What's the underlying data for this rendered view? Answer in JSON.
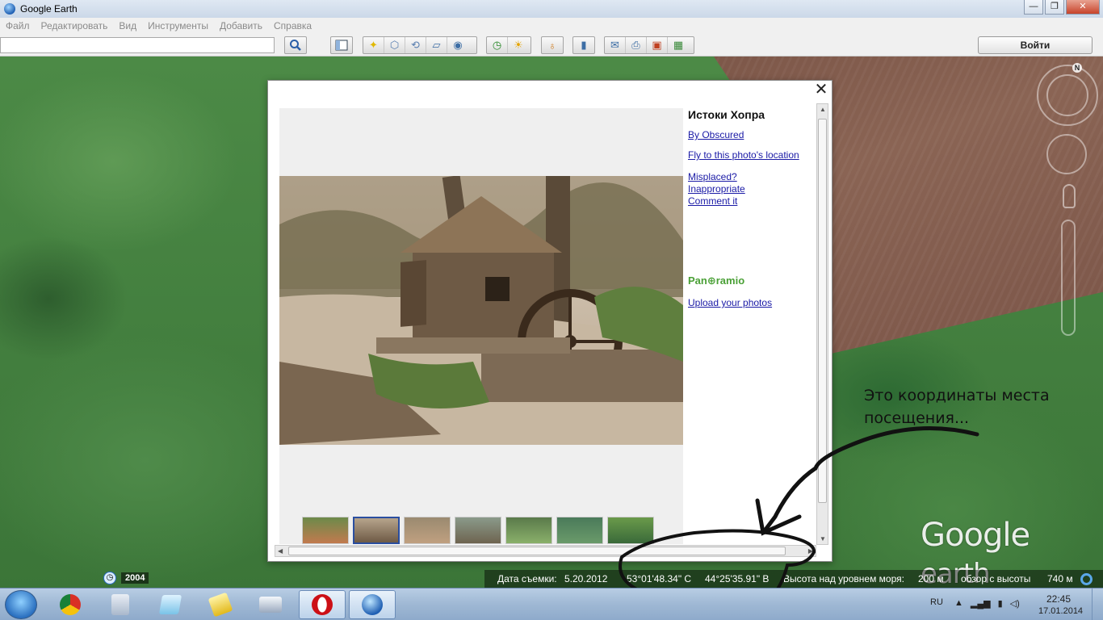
{
  "window": {
    "title": "Google Earth",
    "controls": {
      "minimize": "—",
      "maximize": "❐",
      "close": "✕"
    }
  },
  "menu": [
    "Файл",
    "Редактировать",
    "Вид",
    "Инструменты",
    "Добавить",
    "Справка"
  ],
  "toolbar": {
    "search_value": "",
    "signin_label": "Войти",
    "icons": [
      "sidebar-icon",
      "placemark-icon",
      "polygon-icon",
      "path-icon",
      "overlay-icon",
      "tour-icon",
      "historical-imagery-icon",
      "sunlight-icon",
      "planets-icon",
      "ruler-icon",
      "email-icon",
      "print-icon",
      "save-image-icon",
      "maps-icon"
    ]
  },
  "popup": {
    "title": "Истоки Хопра",
    "author_link": "By Obscured",
    "fly_link": "Fly to this photo's location",
    "misplaced_link": "Misplaced?",
    "inappropriate_link": "Inappropriate",
    "comment_link": "Comment it",
    "panoramio_logo": "Pan⊕ramio",
    "upload_link": "Upload your photos",
    "close_label": "✕"
  },
  "annotation": {
    "text": "Это координаты места посещения..."
  },
  "timeline": {
    "year": "2004"
  },
  "status": {
    "date_label": "Дата съемки:",
    "date_value": "5.20.2012",
    "lat": "53°01'48.34\" С",
    "lon": "44°25'35.91\" В",
    "elevation_label": "Высота над уровнем моря:",
    "elevation_value": "200 м",
    "eye_label": "обзор с высоты",
    "eye_value": "740 м"
  },
  "logo": {
    "google": "Google",
    "earth": "earth"
  },
  "nav": {
    "north": "N"
  },
  "taskbar": {
    "lang": "RU",
    "time": "22:45",
    "date": "17.01.2014",
    "apps": [
      "chrome-icon",
      "calculator-icon",
      "notepad-icon",
      "sticky-icon",
      "keyboard-icon",
      "opera-icon",
      "google-earth-icon"
    ]
  },
  "colors": {
    "link": "#1a1aa6",
    "panoramio": "#4aa036",
    "taskbar": "#9fb8d4"
  }
}
